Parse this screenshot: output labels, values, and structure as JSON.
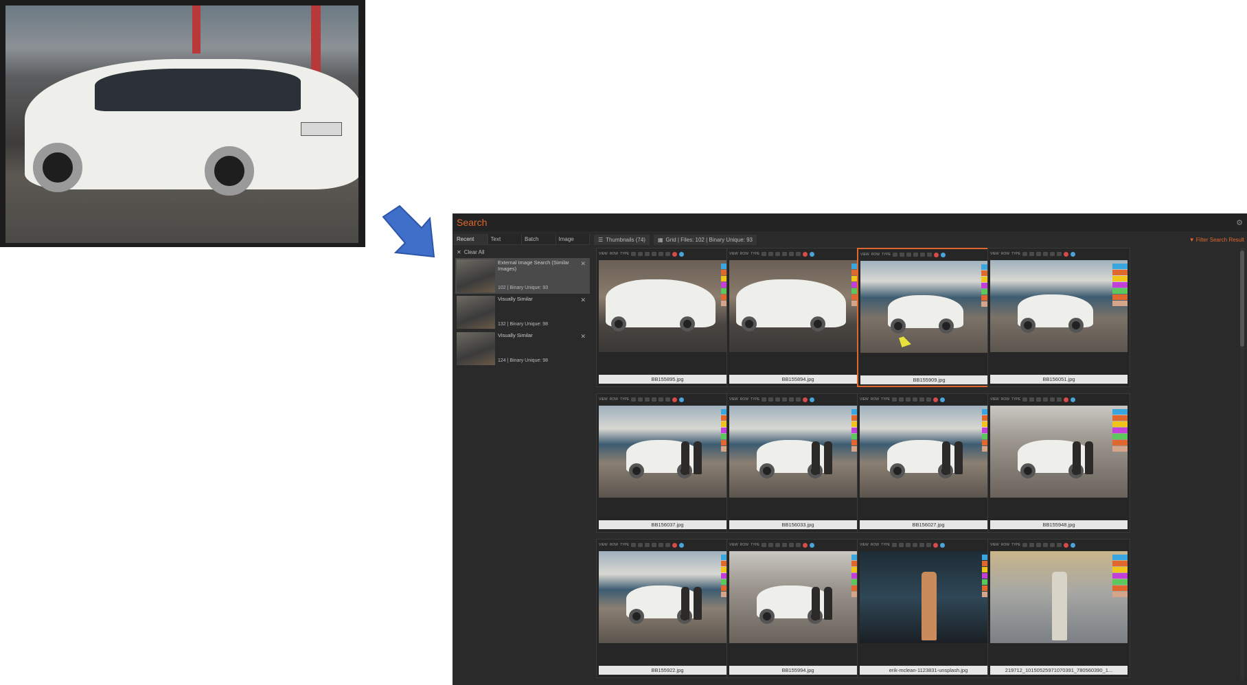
{
  "app": {
    "title": "Search",
    "filter_label": "Filter Search Result",
    "accent": "#e0672e"
  },
  "left_tabs": [
    "Recent",
    "Text",
    "Batch",
    "Image"
  ],
  "clear_all": "Clear All",
  "recent": [
    {
      "title": "External Image Search (Similar Images)",
      "count": "102 | Binary Unique: 93",
      "selected": true
    },
    {
      "title": "Visually Similar",
      "count": "132 | Binary Unique: 98",
      "selected": false
    },
    {
      "title": "Visually Similar",
      "count": "124 | Binary Unique: 98",
      "selected": false
    }
  ],
  "right_tabs": {
    "thumbnails": "Thumbnails (74)",
    "grid": "Grid | Files: 102 | Binary Unique: 93"
  },
  "tile_toolbar": {
    "view": "VIEW",
    "row": "ROW",
    "type": "TYPE",
    "ext": "jpeg"
  },
  "tag_colors": [
    "#3aa6e0",
    "#e0672e",
    "#f0c419",
    "#c23fd8",
    "#5cc75c",
    "#e0672e",
    "#d4a58a"
  ],
  "tiles": [
    {
      "name": "BB155895.jpg",
      "selected": false,
      "scene": "car"
    },
    {
      "name": "BB155894.jpg",
      "selected": false,
      "scene": "car"
    },
    {
      "name": "BB155909.jpg",
      "selected": true,
      "scene": "harbor-car"
    },
    {
      "name": "BB156051.jpg",
      "selected": false,
      "scene": "harbor-car"
    },
    {
      "name": "BB156037.jpg",
      "selected": false,
      "scene": "harbor-people"
    },
    {
      "name": "BB156033.jpg",
      "selected": false,
      "scene": "harbor-people"
    },
    {
      "name": "BB156027.jpg",
      "selected": false,
      "scene": "harbor-people"
    },
    {
      "name": "BB155948.jpg",
      "selected": false,
      "scene": "people-car"
    },
    {
      "name": "BB155922.jpg",
      "selected": false,
      "scene": "harbor-people"
    },
    {
      "name": "BB155994.jpg",
      "selected": false,
      "scene": "people-car"
    },
    {
      "name": "erik-mclean-1123831-unsplash.jpg",
      "selected": false,
      "scene": "woman"
    },
    {
      "name": "219712_10150525971070391_780560390_1...",
      "selected": false,
      "scene": "man-dog"
    }
  ]
}
